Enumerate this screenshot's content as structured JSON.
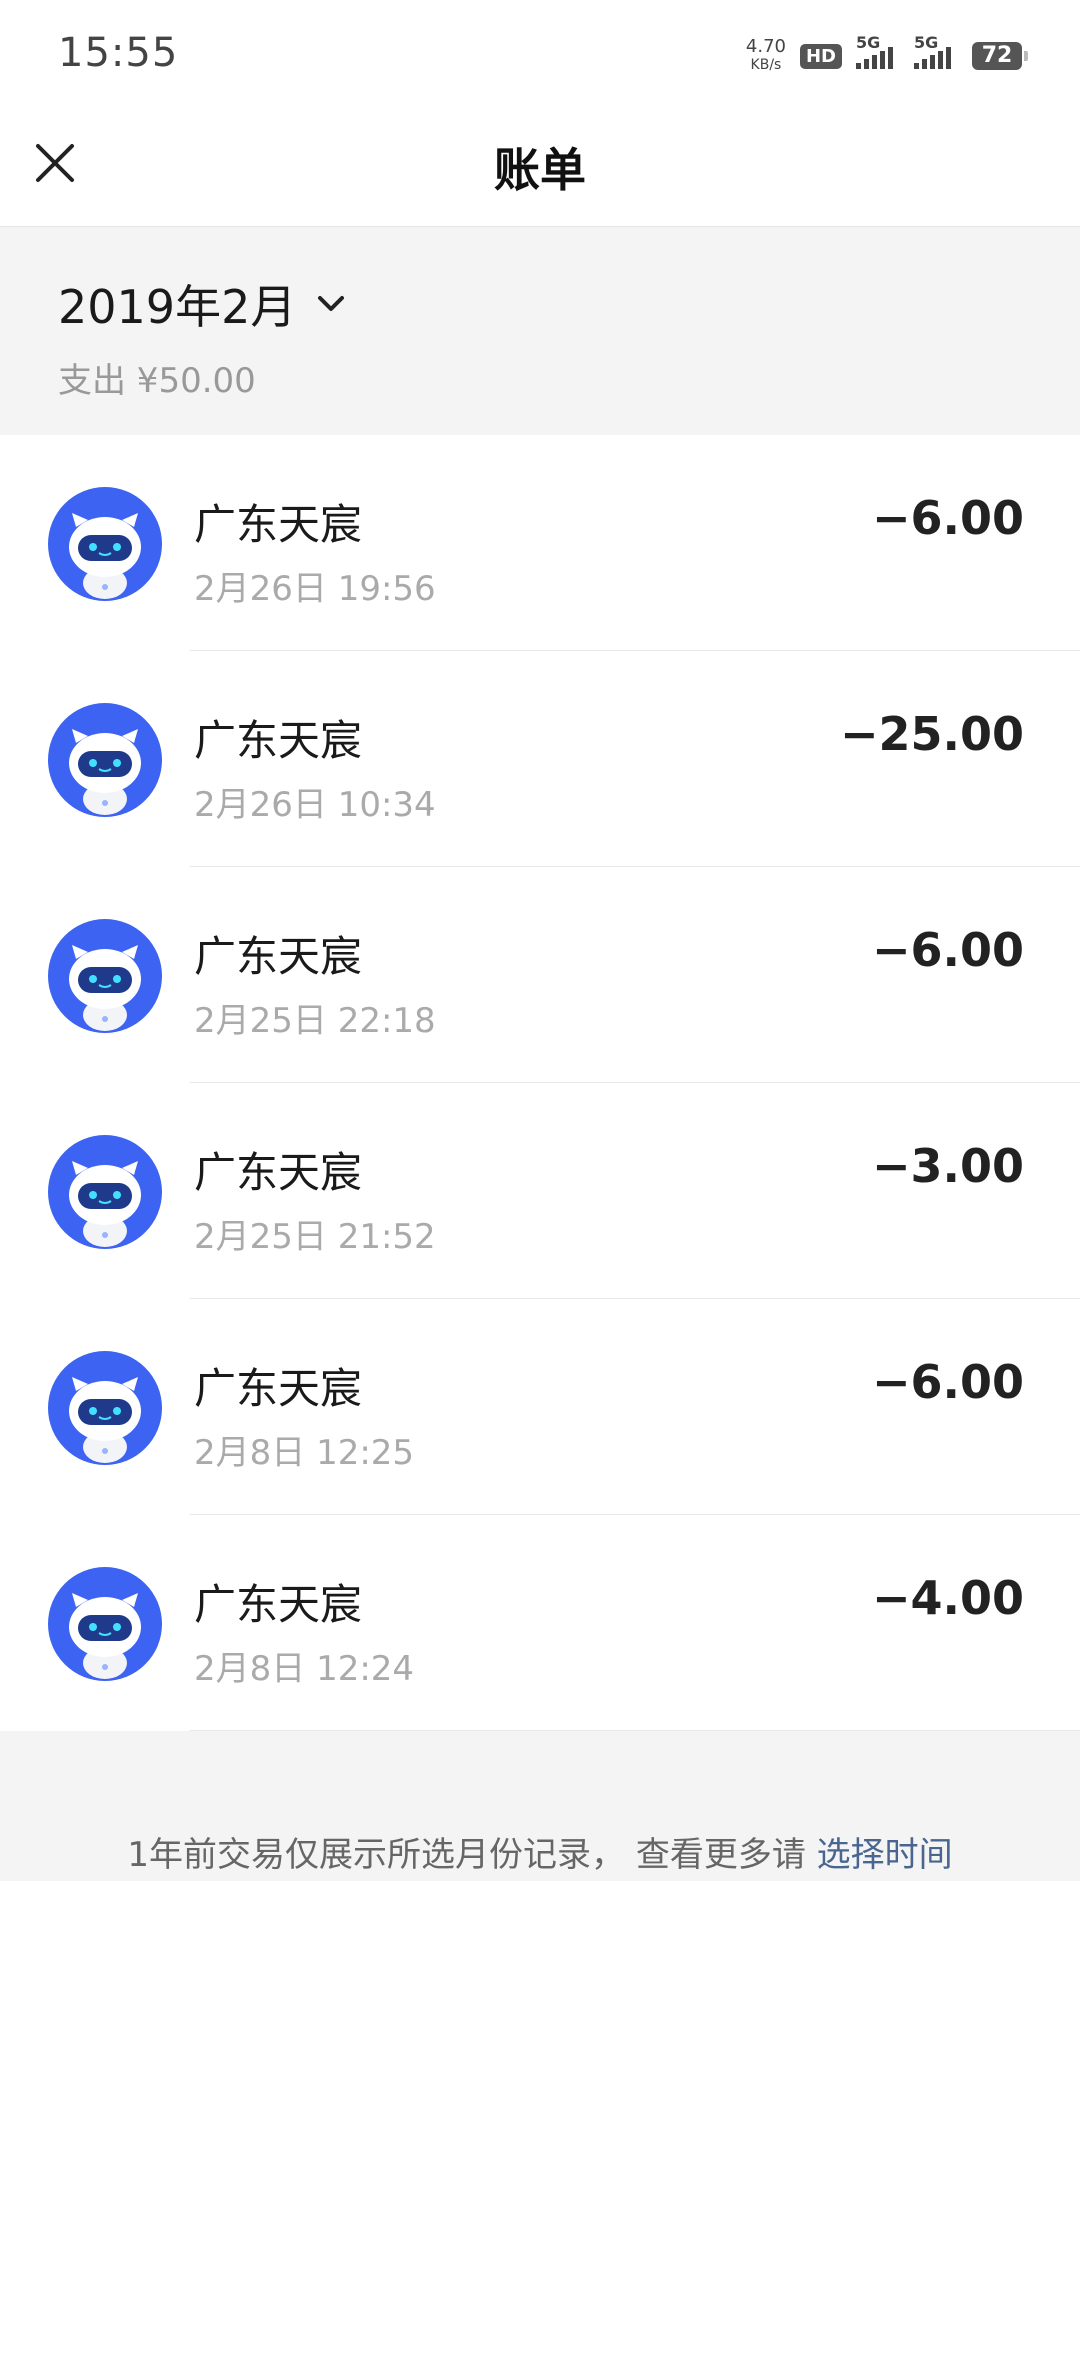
{
  "status_bar": {
    "time": "15:55",
    "speed_value": "4.70",
    "speed_unit": "KB/s",
    "hd": "HD",
    "network1": "5G",
    "network2": "5G",
    "battery": "72"
  },
  "header": {
    "title": "账单",
    "close_icon": "close-icon"
  },
  "summary": {
    "month": "2019年2月",
    "spend": "支出 ¥50.00"
  },
  "transactions": [
    {
      "merchant": "广东天宸",
      "time": "2月26日 19:56",
      "amount": "−6.00"
    },
    {
      "merchant": "广东天宸",
      "time": "2月26日 10:34",
      "amount": "−25.00"
    },
    {
      "merchant": "广东天宸",
      "time": "2月25日 22:18",
      "amount": "−6.00"
    },
    {
      "merchant": "广东天宸",
      "time": "2月25日 21:52",
      "amount": "−3.00"
    },
    {
      "merchant": "广东天宸",
      "time": "2月8日 12:25",
      "amount": "−6.00"
    },
    {
      "merchant": "广东天宸",
      "time": "2月8日 12:24",
      "amount": "−4.00"
    }
  ],
  "footer": {
    "notice": "1年前交易仅展示所选月份记录， 查看更多请 ",
    "link": "选择时间"
  },
  "colors": {
    "avatar_blue": "#3d63f2",
    "link": "#4a6690"
  }
}
